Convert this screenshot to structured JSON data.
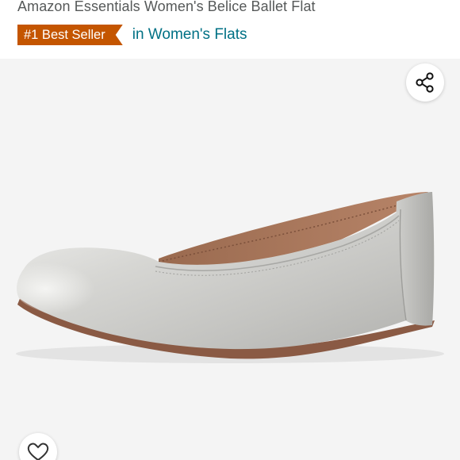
{
  "header": {
    "product_title": "Amazon Essentials Women's Belice Ballet Flat",
    "badge": {
      "label": "#1 Best Seller",
      "category": "in Women's Flats",
      "badge_color": "#c45500",
      "category_color": "#007185"
    }
  },
  "image": {
    "alt": "Silver ballet flat"
  },
  "actions": {
    "share_icon": "share-icon",
    "wishlist_icon": "heart-icon"
  }
}
